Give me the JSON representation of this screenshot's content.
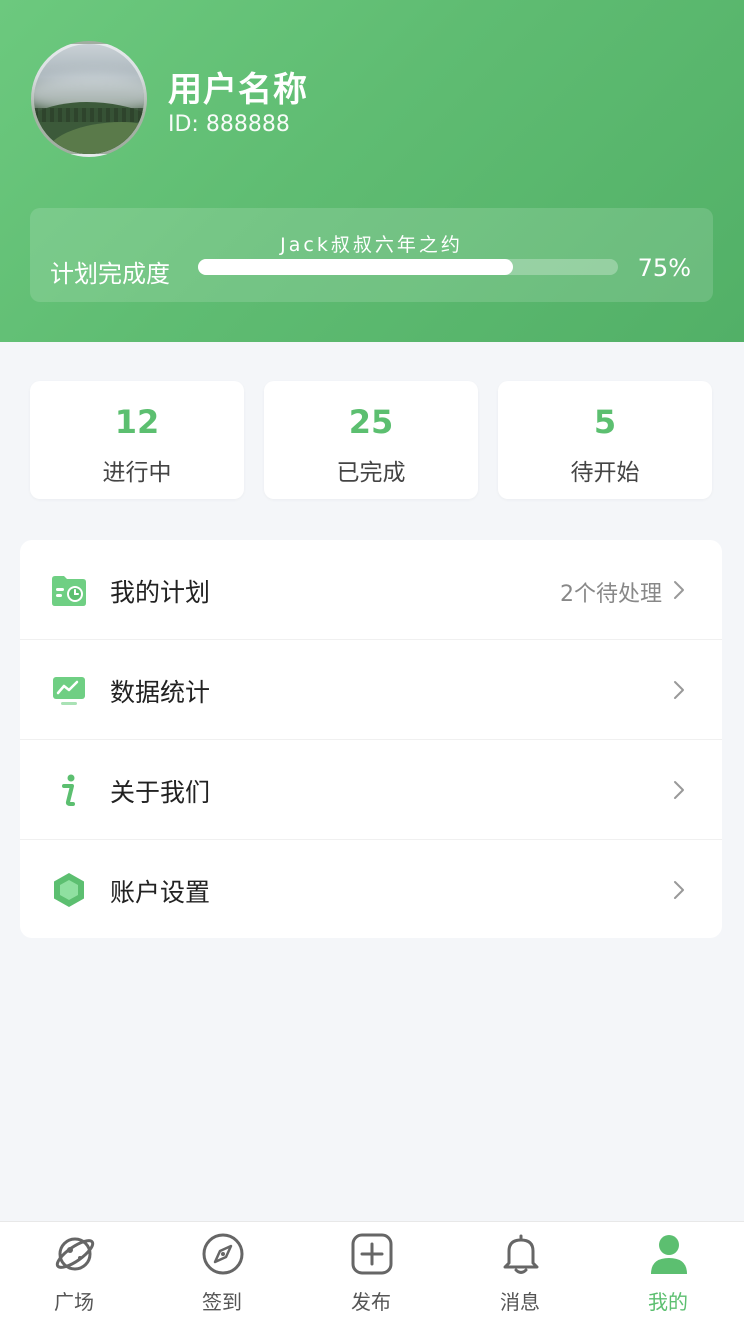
{
  "profile": {
    "name": "用户名称",
    "id_text": "ID: 888888"
  },
  "progress": {
    "plan_name": "Jack叔叔六年之约",
    "label": "计划完成度",
    "percent_text": "75%",
    "value": 0.75
  },
  "stats": [
    {
      "value": "12",
      "label": "进行中"
    },
    {
      "value": "25",
      "label": "已完成"
    },
    {
      "value": "5",
      "label": "待开始"
    }
  ],
  "menu": [
    {
      "label": "我的计划",
      "extra": "2个待处理",
      "icon": "folder-clock-icon"
    },
    {
      "label": "数据统计",
      "extra": "",
      "icon": "chart-monitor-icon"
    },
    {
      "label": "关于我们",
      "extra": "",
      "icon": "info-icon"
    },
    {
      "label": "账户设置",
      "extra": "",
      "icon": "hexagon-icon"
    }
  ],
  "tabbar": [
    {
      "label": "广场",
      "icon": "planet-icon",
      "active": false
    },
    {
      "label": "签到",
      "icon": "compass-icon",
      "active": false
    },
    {
      "label": "发布",
      "icon": "plus-square-icon",
      "active": false
    },
    {
      "label": "消息",
      "icon": "bell-icon",
      "active": false
    },
    {
      "label": "我的",
      "icon": "user-icon",
      "active": true
    }
  ],
  "colors": {
    "accent": "#5cbf70",
    "header_start": "#6cc97e",
    "header_end": "#52b067",
    "background": "#f4f6f9"
  }
}
